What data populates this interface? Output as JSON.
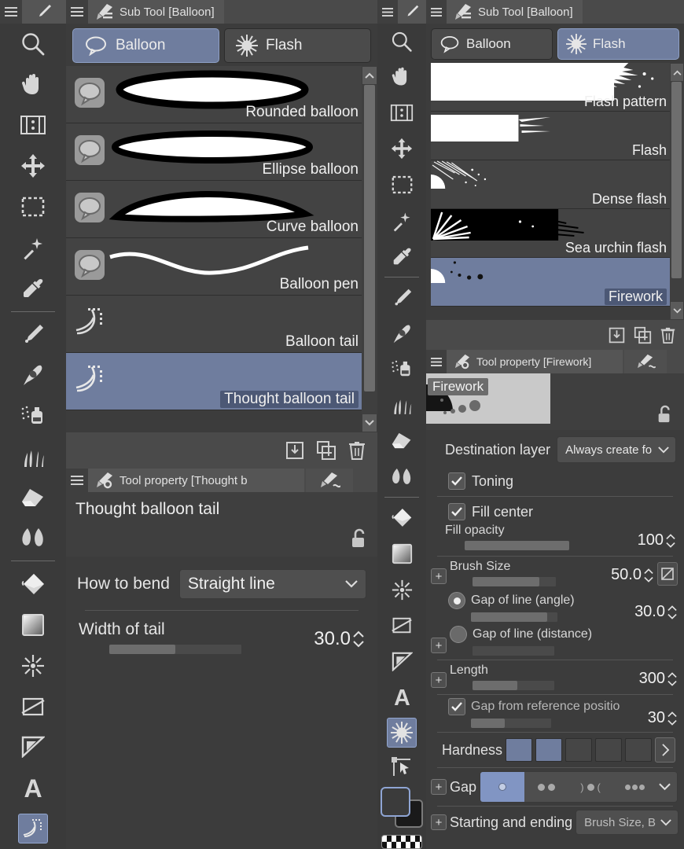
{
  "left_panel": {
    "titlebar": {
      "title": "Sub Tool [Balloon]",
      "menu_icon": "hamburger-icon",
      "tab_icon": "sub-tool-icon"
    },
    "group_tabs": [
      {
        "label": "Balloon",
        "icon": "speech-balloon-icon",
        "active": true
      },
      {
        "label": "Flash",
        "icon": "flash-star-icon",
        "active": false
      }
    ],
    "sub_tools": [
      {
        "label": "Rounded balloon",
        "icon": "balloon-icon",
        "preview": "rounded-balloon",
        "selected": false
      },
      {
        "label": "Ellipse balloon",
        "icon": "balloon-icon",
        "preview": "ellipse-balloon",
        "selected": false
      },
      {
        "label": "Curve balloon",
        "icon": "balloon-icon",
        "preview": "curve-balloon",
        "selected": false
      },
      {
        "label": "Balloon pen",
        "icon": "balloon-icon",
        "preview": "balloon-pen",
        "selected": false
      },
      {
        "label": "Balloon tail",
        "icon": "balloon-tail-icon",
        "preview": "balloon-tail",
        "selected": false
      },
      {
        "label": "Thought balloon tail",
        "icon": "balloon-tail-icon",
        "preview": "thought-balloon-tail",
        "selected": true
      }
    ],
    "list_footer": [
      {
        "icon": "import-icon",
        "name": "import-sub-tool-button"
      },
      {
        "icon": "duplicate-icon",
        "name": "duplicate-sub-tool-button"
      },
      {
        "icon": "trash-icon",
        "name": "delete-sub-tool-button"
      }
    ],
    "tool_property": {
      "titlebar": {
        "title": "Tool property [Thought b",
        "menu_icon": "hamburger-icon",
        "tab_icon": "tool-property-icon",
        "tab2_icon": "brush-wave-icon"
      },
      "tool_name": "Thought balloon tail",
      "lock_icon": "unlocked-padlock-icon",
      "how_to_bend": {
        "label": "How to bend",
        "value": "Straight line"
      },
      "width_of_tail": {
        "label": "Width of tail",
        "value": "30.0",
        "fill_percent": 50
      }
    }
  },
  "right_panel": {
    "titlebar": {
      "title": "Sub Tool [Balloon]",
      "menu_icon": "hamburger-icon",
      "tab_icon": "sub-tool-icon"
    },
    "group_tabs": [
      {
        "label": "Balloon",
        "icon": "speech-balloon-icon",
        "active": false
      },
      {
        "label": "Flash",
        "icon": "flash-star-icon",
        "active": true
      }
    ],
    "sub_tools": [
      {
        "label": "Flash pattern",
        "preview": "flash-pattern",
        "selected": false
      },
      {
        "label": "Flash",
        "preview": "flash",
        "selected": false
      },
      {
        "label": "Dense flash",
        "preview": "dense-flash",
        "selected": false
      },
      {
        "label": "Sea urchin flash",
        "preview": "sea-urchin-flash",
        "selected": false
      },
      {
        "label": "Firework",
        "preview": "firework",
        "selected": true
      }
    ],
    "list_footer": [
      {
        "icon": "import-icon",
        "name": "import-sub-tool-button"
      },
      {
        "icon": "duplicate-icon",
        "name": "duplicate-sub-tool-button"
      },
      {
        "icon": "trash-icon",
        "name": "delete-sub-tool-button"
      }
    ],
    "tool_property": {
      "titlebar": {
        "title": "Tool property [Firework]",
        "menu_icon": "hamburger-icon",
        "tab_icon": "tool-property-icon",
        "tab2_icon": "brush-wave-icon"
      },
      "tool_name": "Firework",
      "lock_icon": "unlocked-padlock-icon",
      "destination_layer": {
        "label": "Destination layer",
        "value": "Always create fo"
      },
      "toning": {
        "label": "Toning",
        "checked": true
      },
      "fill_center": {
        "label": "Fill center",
        "checked": true
      },
      "fill_opacity": {
        "label": "Fill opacity",
        "value": "100",
        "fill_percent": 100
      },
      "brush_size": {
        "label": "Brush Size",
        "value": "50.0",
        "fill_percent": 80
      },
      "gap_of_line_angle": {
        "label": "Gap of line (angle)",
        "value": "30.0",
        "fill_percent": 88,
        "selected": true
      },
      "gap_of_line_distance": {
        "label": "Gap of line (distance)",
        "value": "",
        "fill_percent": 0,
        "selected": false
      },
      "length": {
        "label": "Length",
        "value": "300",
        "fill_percent": 55
      },
      "gap_from_reference": {
        "label": "Gap from reference positio",
        "value": "30",
        "checked": true,
        "fill_percent": 42
      },
      "hardness": {
        "label": "Hardness",
        "steps": 6,
        "active_steps": 2
      },
      "gap": {
        "label": "Gap",
        "selected_index": 0
      },
      "starting_and_ending": {
        "label": "Starting and ending",
        "value": "Brush Size, B"
      }
    }
  },
  "toolbars": {
    "left": {
      "header": {
        "menu_icon": "hamburger-icon",
        "pen_icon": "pen-icon"
      },
      "tools": [
        {
          "name": "zoom-tool",
          "icon": "magnifier-icon",
          "selected": false
        },
        {
          "name": "hand-tool",
          "icon": "hand-icon",
          "selected": false
        },
        {
          "name": "rotate-tool",
          "icon": "rotate-canvas-icon",
          "selected": false
        },
        {
          "name": "move-tool",
          "icon": "move-arrows-icon",
          "selected": false
        },
        {
          "name": "selection-tool",
          "icon": "marquee-dashed-icon",
          "selected": false
        },
        {
          "name": "auto-select-tool",
          "icon": "magic-wand-icon",
          "selected": false
        },
        {
          "name": "eyedropper-tool",
          "icon": "eyedropper-icon",
          "selected": false
        },
        {
          "name": "pen-tool",
          "icon": "pen-nib-icon",
          "selected": false
        },
        {
          "name": "brush-tool",
          "icon": "paintbrush-icon",
          "selected": false
        },
        {
          "name": "airbrush-tool",
          "icon": "airbrush-icon",
          "selected": false
        },
        {
          "name": "decoration-tool",
          "icon": "grass-icon",
          "selected": false
        },
        {
          "name": "eraser-tool",
          "icon": "eraser-icon",
          "selected": false
        },
        {
          "name": "blend-tool",
          "icon": "blend-drops-icon",
          "selected": false
        },
        {
          "name": "fill-tool",
          "icon": "paint-bucket-icon",
          "selected": false
        },
        {
          "name": "gradient-tool",
          "icon": "gradient-square-icon",
          "selected": false
        },
        {
          "name": "figure-tool",
          "icon": "burst-icon",
          "selected": false
        },
        {
          "name": "frame-border-tool",
          "icon": "frame-slash-icon",
          "selected": false
        },
        {
          "name": "ruler-tool",
          "icon": "ruler-triangle-icon",
          "selected": false
        },
        {
          "name": "text-tool",
          "icon": "letter-a-icon",
          "selected": false
        },
        {
          "name": "balloon-tool",
          "icon": "balloon-tail-icon",
          "selected": true
        }
      ]
    },
    "right": {
      "header": {
        "menu_icon": "hamburger-icon",
        "pen_icon": "pen-icon"
      },
      "tools": [
        {
          "name": "zoom-tool",
          "icon": "magnifier-icon",
          "selected": false
        },
        {
          "name": "hand-tool",
          "icon": "hand-icon",
          "selected": false
        },
        {
          "name": "rotate-tool",
          "icon": "rotate-canvas-icon",
          "selected": false
        },
        {
          "name": "move-tool",
          "icon": "move-arrows-icon",
          "selected": false
        },
        {
          "name": "selection-tool",
          "icon": "marquee-dashed-icon",
          "selected": false
        },
        {
          "name": "auto-select-tool",
          "icon": "magic-wand-icon",
          "selected": false
        },
        {
          "name": "eyedropper-tool",
          "icon": "eyedropper-icon",
          "selected": false
        },
        {
          "name": "pen-tool",
          "icon": "pen-nib-icon",
          "selected": false
        },
        {
          "name": "brush-tool",
          "icon": "paintbrush-icon",
          "selected": false
        },
        {
          "name": "airbrush-tool",
          "icon": "airbrush-icon",
          "selected": false
        },
        {
          "name": "decoration-tool",
          "icon": "grass-icon",
          "selected": false
        },
        {
          "name": "eraser-tool",
          "icon": "eraser-icon",
          "selected": false
        },
        {
          "name": "blend-tool",
          "icon": "blend-drops-icon",
          "selected": false
        },
        {
          "name": "fill-tool",
          "icon": "paint-bucket-icon",
          "selected": false
        },
        {
          "name": "gradient-tool",
          "icon": "gradient-square-icon",
          "selected": false
        },
        {
          "name": "figure-tool",
          "icon": "burst-icon",
          "selected": false
        },
        {
          "name": "frame-border-tool",
          "icon": "frame-slash-icon",
          "selected": false
        },
        {
          "name": "ruler-tool",
          "icon": "ruler-triangle-icon",
          "selected": false
        },
        {
          "name": "text-tool",
          "icon": "letter-a-icon",
          "selected": false
        },
        {
          "name": "flash-tool",
          "icon": "flash-star-icon",
          "selected": true
        },
        {
          "name": "operation-tool",
          "icon": "object-pointer-icon",
          "selected": false
        }
      ],
      "color_swatches": {
        "main": "#3b3b3b",
        "sub": "#1a1a1a",
        "transparent": "checker-icon"
      }
    }
  },
  "colors": {
    "selection_blue": "#6f7d9e",
    "panel_bg": "#3c3c3c",
    "list_item_bg": "#434343",
    "titlebar_bg": "#4a4a4a",
    "toolbar_bg": "#3a3a3a",
    "text": "#e8e8e8"
  }
}
